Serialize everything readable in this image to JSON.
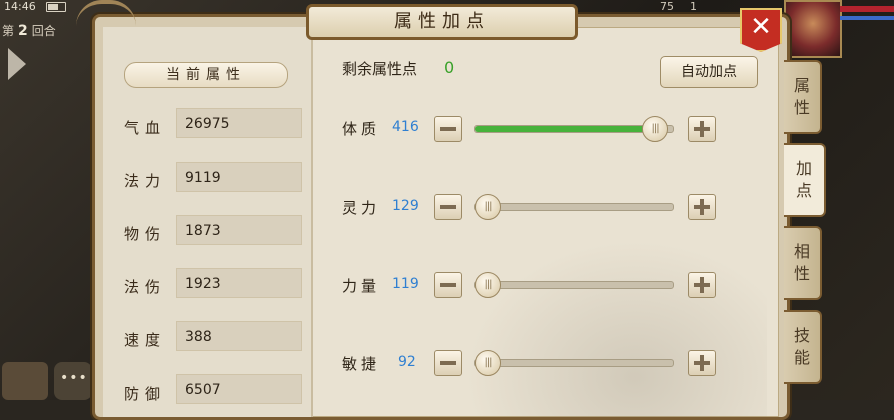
{
  "status": {
    "time": "14:46"
  },
  "round": {
    "prefix": "第",
    "number": "2",
    "suffix": "回合"
  },
  "hud": {
    "enemy_count_1": "75",
    "enemy_count_2": "1"
  },
  "dialog": {
    "title": "属性加点",
    "close_label": "✕"
  },
  "current_attributes": {
    "header": "当前属性",
    "items": [
      {
        "label": "气血",
        "value": "26975"
      },
      {
        "label": "法力",
        "value": "9119"
      },
      {
        "label": "物伤",
        "value": "1873"
      },
      {
        "label": "法伤",
        "value": "1923"
      },
      {
        "label": "速度",
        "value": "388"
      },
      {
        "label": "防御",
        "value": "6507"
      }
    ]
  },
  "allocation": {
    "remaining_label": "剩余属性点",
    "remaining_value": "0",
    "auto_button_label": "自动加点",
    "handle_glyph": "|||",
    "stats": [
      {
        "name": "体质",
        "value": "416",
        "fill": 0.96,
        "color": "#47b23b"
      },
      {
        "name": "灵力",
        "value": "129",
        "fill": 0.0
      },
      {
        "name": "力量",
        "value": "119",
        "fill": 0.0
      },
      {
        "name": "敏捷",
        "value": "92",
        "fill": 0.0
      }
    ]
  },
  "side_tabs": [
    {
      "label": "属性",
      "active": false
    },
    {
      "label": "加点",
      "active": true
    },
    {
      "label": "相性",
      "active": false
    },
    {
      "label": "技能",
      "active": false
    }
  ]
}
